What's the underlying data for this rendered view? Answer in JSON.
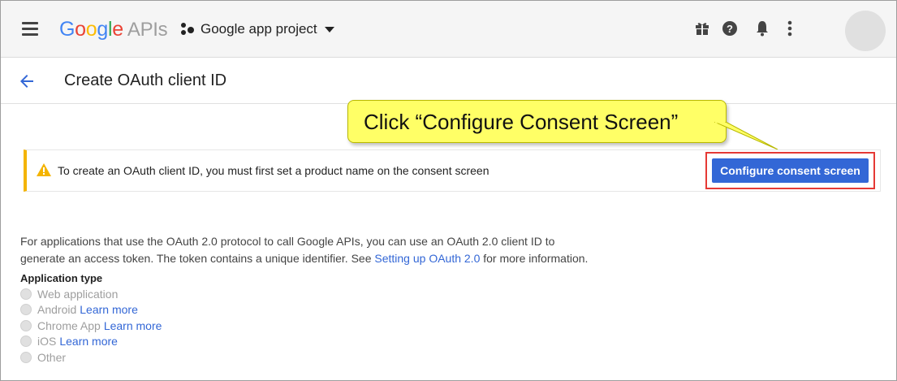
{
  "header": {
    "logo": {
      "g1": "G",
      "o1": "o",
      "o2": "o",
      "g2": "g",
      "l": "l",
      "e": "e",
      "apis": "APIs"
    },
    "project_name": "Google app project",
    "icons": [
      "menu-icon",
      "gift-icon",
      "help-icon",
      "notifications-icon",
      "more-vert-icon",
      "avatar"
    ]
  },
  "subheader": {
    "title": "Create OAuth client ID"
  },
  "callout": {
    "text": "Click “Configure Consent Screen”",
    "background": "#ffff66"
  },
  "warning": {
    "text": "To create an OAuth client ID, you must first set a product name on the consent screen",
    "button_label": "Configure consent screen",
    "accent": "#f4b400",
    "button_color": "#3367d6",
    "highlight_color": "#e53935"
  },
  "description": {
    "line1": "For applications that use the OAuth 2.0 protocol to call Google APIs, you can use an OAuth 2.0 client ID to",
    "line2_pre": "generate an access token. The token contains a unique identifier. See ",
    "link": "Setting up OAuth 2.0",
    "line2_post": " for more information."
  },
  "application_type": {
    "label": "Application type",
    "options": [
      {
        "label": "Web application",
        "link": ""
      },
      {
        "label": "Android",
        "link": "Learn more"
      },
      {
        "label": "Chrome App",
        "link": "Learn more"
      },
      {
        "label": "iOS",
        "link": "Learn more"
      },
      {
        "label": "Other",
        "link": ""
      }
    ]
  }
}
